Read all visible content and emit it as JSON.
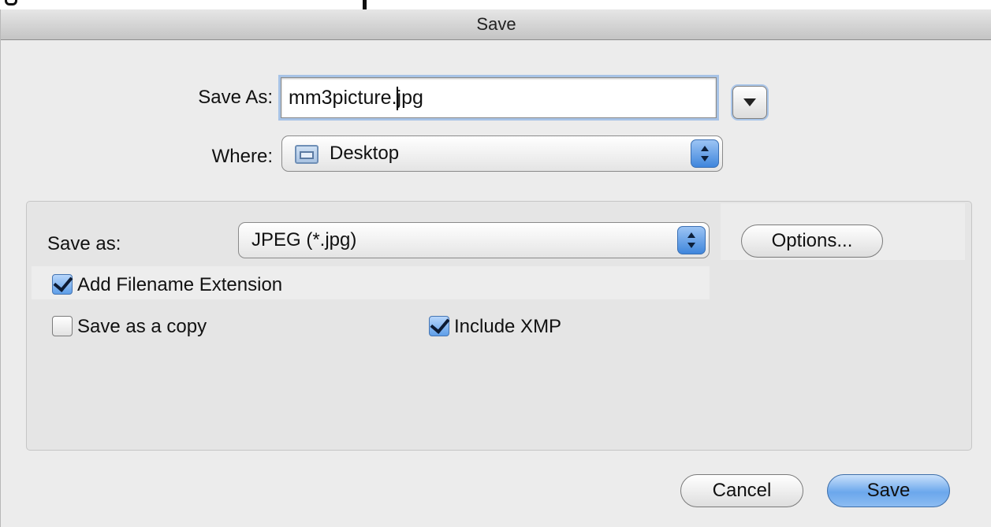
{
  "window": {
    "title": "Save"
  },
  "save_as": {
    "label": "Save As:",
    "filename_before_caret": "mm3picture.",
    "filename_after_caret": "jpg"
  },
  "where": {
    "label": "Where:",
    "selected": "Desktop",
    "icon": "folder-icon"
  },
  "options_panel": {
    "format_label": "Save as:",
    "format_selected": "JPEG (*.jpg)",
    "options_button": "Options...",
    "add_extension": {
      "label": "Add Filename Extension",
      "checked": true
    },
    "save_copy": {
      "label": "Save as a copy",
      "checked": false
    },
    "include_xmp": {
      "label": "Include XMP",
      "checked": true
    }
  },
  "buttons": {
    "cancel": "Cancel",
    "save": "Save"
  },
  "colors": {
    "accent": "#5e9ee8",
    "window_bg": "#ececec",
    "focus_ring": "#a7c3e6"
  }
}
